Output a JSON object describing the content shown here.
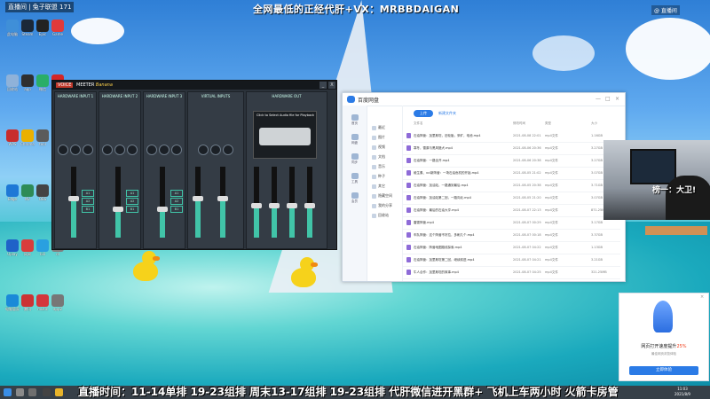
{
  "top": {
    "live_info": "直播间 | 兔子联盟 171",
    "promo": "全网最低的正经代肝+VX：MRBBDAIGAN",
    "tr_badge": "@ 直播间"
  },
  "desktop_icons": [
    {
      "label": "此电脑",
      "color": "#3f8fd8"
    },
    {
      "label": "Steam",
      "color": "#1b2838"
    },
    {
      "label": "Epic",
      "color": "#222"
    },
    {
      "label": "Game",
      "color": "#e03a3a"
    },
    {
      "label": "回收站",
      "color": "#8fb2d9"
    },
    {
      "label": "app",
      "color": "#2f2f2f"
    },
    {
      "label": "微信",
      "color": "#2aae67"
    },
    {
      "label": "Adobe",
      "color": "#d32626"
    },
    {
      "label": "WPS",
      "color": "#c82d2d"
    },
    {
      "label": "Chrome",
      "color": "#eab000"
    },
    {
      "label": "tool",
      "color": "#5b5b5b"
    },
    {
      "label": "set",
      "color": "#5a8a3a"
    },
    {
      "label": "Edge",
      "color": "#1e78d6"
    },
    {
      "label": "NV",
      "color": "#2e8b57"
    },
    {
      "label": "OBS",
      "color": "#444"
    },
    {
      "label": "QQ",
      "color": "#3aa0e8"
    },
    {
      "label": "Uplay",
      "color": "#1f62c8"
    },
    {
      "label": "网易",
      "color": "#d93c3c"
    },
    {
      "label": "bili",
      "color": "#2aa0e0"
    },
    {
      "label": "dl",
      "color": "#808080"
    },
    {
      "label": "电脑管家",
      "color": "#1a8ad8"
    },
    {
      "label": "腾讯",
      "color": "#c33"
    },
    {
      "label": "music",
      "color": "#d4363b"
    },
    {
      "label": "app2",
      "color": "#777"
    }
  ],
  "voicemeeter": {
    "logo": "VOICE",
    "title": "MEETER",
    "edition": "Banana",
    "min_label": "_",
    "close_label": "X",
    "strips": [
      {
        "name": "HARDWARE INPUT 1",
        "level": 0.55
      },
      {
        "name": "HARDWARE INPUT 2",
        "level": 0.4
      },
      {
        "name": "HARDWARE INPUT 3",
        "level": 0.4
      },
      {
        "name": "VIRTUAL INPUTS",
        "level": 0.55
      },
      {
        "name": "HARDWARE OUT",
        "level": 0.45
      }
    ],
    "bus_a1": "A1",
    "bus_a2": "A2",
    "bus_b1": "B1",
    "cassette_text": "Click to Select Audio file for Playback"
  },
  "netdisk": {
    "app_name": "百度网盘",
    "sidebar": [
      "首页",
      "网盘",
      "同步",
      "工具",
      "会员"
    ],
    "nav": [
      "最近",
      "图片",
      "视频",
      "文档",
      "音乐",
      "种子",
      "其它",
      "隐藏空间",
      "我的分享",
      "回收站"
    ],
    "upload_label": "上传",
    "new_folder_label": "新建文件夹",
    "columns": {
      "name": "文件名",
      "date": "修改时间",
      "type": "类型",
      "size": "大小"
    },
    "files": [
      {
        "name": "石油阵营：加里斯坦，旧轮胎，采矿，电池.mp4",
        "date": "2021-08-08 22:01",
        "type": "mp4文件",
        "size": "1.16GB"
      },
      {
        "name": "寒冬，雪原与黑风猎犬.mp4",
        "date": "2021-08-06 20:36",
        "type": "mp4文件",
        "size": "3.27GB"
      },
      {
        "name": "石油阵营：一路全开.mp4",
        "date": "2021-08-06 20:38",
        "type": "mp4文件",
        "size": "3.27GB"
      },
      {
        "name": "维生素、vci新阵营：一场石油危机的开始.mp4",
        "date": "2021-08-05 21:02",
        "type": "mp4文件",
        "size": "3.07GB"
      },
      {
        "name": "石油阵营：加油站，一路通到最后.mp4",
        "date": "2021-08-05 20:38",
        "type": "mp4文件",
        "size": "3.71GB"
      },
      {
        "name": "石油阵营：加油站第二回，一路向北.mp4",
        "date": "2021-08-05 21:20",
        "type": "mp4文件",
        "size": "3.07GB"
      },
      {
        "name": "石油阵营：最后的石油大亨.mp4",
        "date": "2021-08-07 22:13",
        "type": "mp4文件",
        "size": "871.25MB"
      },
      {
        "name": "雷霆阵营.mp4",
        "date": "2021-08-07 00:29",
        "type": "mp4文件",
        "size": "3.17GB"
      },
      {
        "name": "车队阵营：这个阵营不好拉，多刷几个.mp4",
        "date": "2021-08-07 00:18",
        "type": "mp4文件",
        "size": "3.37GB"
      },
      {
        "name": "石油阵营：阵营地图路线探索.mp4",
        "date": "2021-08-07 04:22",
        "type": "mp4文件",
        "size": "1.13GB"
      },
      {
        "name": "石油阵营：加里斯坦第二回，继续前进.mp4",
        "date": "2021-08-07 04:21",
        "type": "mp4文件",
        "size": "3.21GB"
      },
      {
        "name": "牛人合作：加里斯坦的故事.mp4",
        "date": "2021-08-07 04:25",
        "type": "mp4文件",
        "size": "321.25MB"
      }
    ]
  },
  "cam_banner": "榜一：大卫!",
  "popup": {
    "title_pre": "网页打开速度提升",
    "title_pct": "25%",
    "subtitle": "最佳网页浏览体验",
    "button": "立即体验",
    "close": "×"
  },
  "ticker": "直播时间：11-14单排 19-23组排 周末13-17组排 19-23组排 代肝微信进开黑群+ 飞机上车两小时 火箭卡房管",
  "taskbar": {
    "time": "11:03",
    "date": "2021/8/9"
  }
}
